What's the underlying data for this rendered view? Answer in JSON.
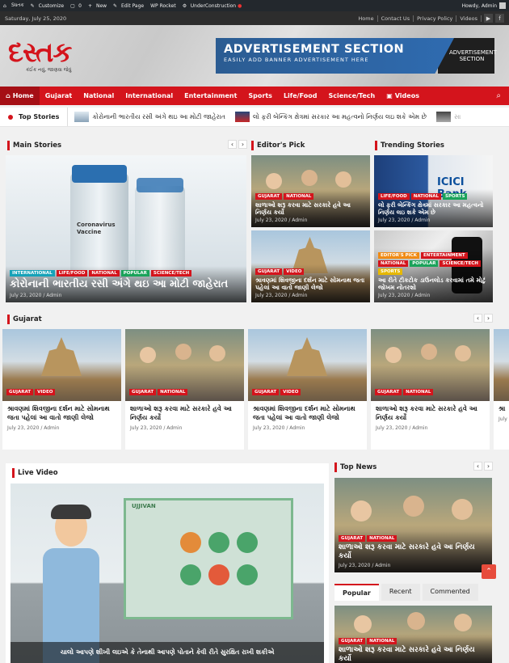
{
  "admin_bar": {
    "site": "Sધતક",
    "customize": "Customize",
    "comments": "0",
    "new": "New",
    "edit_page": "Edit Page",
    "wp_rocket": "WP Rocket",
    "under_construction": "UnderConstruction",
    "howdy": "Howdy, Admin"
  },
  "top_bar": {
    "date": "Saturday, July 25, 2020",
    "links": [
      "Home",
      "Contact Us",
      "Privacy Policy",
      "Videos"
    ]
  },
  "header": {
    "logo": "દસ્તક",
    "tagline": "કંઈક નવું, જાણવા જેવું",
    "ad_title": "ADVERTISEMENT SECTION",
    "ad_sub": "EASILY ADD BANNER ADVERTISEMENT HERE",
    "ad_side": "ADVERTISEMENT SECTION"
  },
  "nav": {
    "items": [
      "Home",
      "Gujarat",
      "National",
      "International",
      "Entertainment",
      "Sports",
      "Life/Food",
      "Science/Tech",
      "Videos"
    ]
  },
  "ticker": {
    "label": "Top Stories",
    "items": [
      "કોરોનાની ભારતીય રસી અંગે થઇ આ મોટી જાહેરાત",
      "લો ફરી બેન્કિંગ ક્ષેત્રમાં સરકાર આ મહત્વનો નિર્ણય લઇ શકે એમ છે",
      "સા"
    ]
  },
  "main_stories": {
    "title": "Main Stories",
    "cats": [
      "INTERNATIONAL",
      "LIFE/FOOD",
      "NATIONAL",
      "POPULAR",
      "SCIENCE/TECH"
    ],
    "headline": "કોરોનાની ભારતીય રસી અંગે થઇ આ મોટી જાહેરાત",
    "meta": "July 23, 2020 / Admin",
    "vial_text": "Coronavirus Vaccine"
  },
  "editors_pick": {
    "title": "Editor's Pick",
    "cards": [
      {
        "cats": [
          "GUJARAT",
          "NATIONAL"
        ],
        "title": "શાળાઓ શરૂ કરવા માટે સરકારે હવે આ નિર્ણય કર્યો",
        "meta": "July 23, 2020 / Admin"
      },
      {
        "cats": [
          "GUJARAT",
          "VIDEO"
        ],
        "title": "શ્રાવણમાં શિવજીના દર્શન માટે સોમનાથ જતા પહેલાં આ વાતો જાણી લેજો",
        "meta": "July 23, 2020 / Admin"
      }
    ]
  },
  "trending": {
    "title": "Trending Stories",
    "cards": [
      {
        "cats": [
          "LIFE/FOOD",
          "NATIONAL",
          "SPORTS"
        ],
        "title": "લો ફરી બેન્કિંગ ક્ષેત્રમાં સરકાર આ મહત્વનો નિર્ણય લઇ શકે એમ છે",
        "meta": "July 23, 2020 / Admin",
        "bank": "ICICI Bank"
      },
      {
        "cats": [
          "EDITOR'S PICK",
          "ENTERTAINMENT",
          "NATIONAL",
          "POPULAR",
          "SCIENCE/TECH",
          "SPORTS"
        ],
        "title": "આ રીતે ટીકટોક ડાઉનલોડ કરવામાં તમે મોટું જોખમ નોતરશો",
        "meta": "July 23, 2020 / Admin"
      }
    ]
  },
  "gujarat": {
    "title": "Gujarat",
    "cards": [
      {
        "img": "temple",
        "cats": [
          "GUJARAT",
          "VIDEO"
        ],
        "title": "શ્રાવણમાં શિવજીના દર્શન માટે સોમનાથ જતા પહેલાં આ વાતો જાણી લેજો",
        "meta": "July 23, 2020 / Admin"
      },
      {
        "img": "class",
        "cats": [
          "GUJARAT",
          "NATIONAL"
        ],
        "title": "શાળાઓ શરૂ કરવા માટે સરકારે હવે આ નિર્ણય કર્યો",
        "meta": "July 23, 2020 / Admin"
      },
      {
        "img": "temple",
        "cats": [
          "GUJARAT",
          "VIDEO"
        ],
        "title": "શ્રાવણમાં શિવજીના દર્શન માટે સોમનાથ જતા પહેલાં આ વાતો જાણી લેજો",
        "meta": "July 23, 2020 / Admin"
      },
      {
        "img": "class",
        "cats": [
          "GUJARAT",
          "NATIONAL"
        ],
        "title": "શાળાઓ શરૂ કરવા માટે સરકારે હવે આ નિર્ણય કર્યો",
        "meta": "July 23, 2020 / Admin"
      }
    ],
    "peek_title": "શ્રા",
    "peek_meta": "July"
  },
  "live_video": {
    "title": "Live Video",
    "brand": "UJJIVAN",
    "caption": "ચાલો આપણે શીખી લઇએ કે તેનાથી આપણે પોતાને કેવી રીતે સુરક્ષિત રાખી શકીએ"
  },
  "top_news": {
    "title": "Top News",
    "cats": [
      "GUJARAT",
      "NATIONAL"
    ],
    "headline": "શાળાઓ શરૂ કરવા માટે સરકારે હવે આ નિર્ણય કર્યો",
    "meta": "July 23, 2020 / Admin"
  },
  "tabs": {
    "items": [
      "Popular",
      "Recent",
      "Commented"
    ],
    "card_cats": [
      "GUJARAT",
      "NATIONAL"
    ],
    "card_title": "શાળાઓ શરૂ કરવા માટે સરકારે હવે આ નિર્ણય કર્યો"
  },
  "colors": {
    "brand_red": "#d4141c",
    "dark": "#2d2d2d",
    "ad_blue": "#2b5c92"
  }
}
